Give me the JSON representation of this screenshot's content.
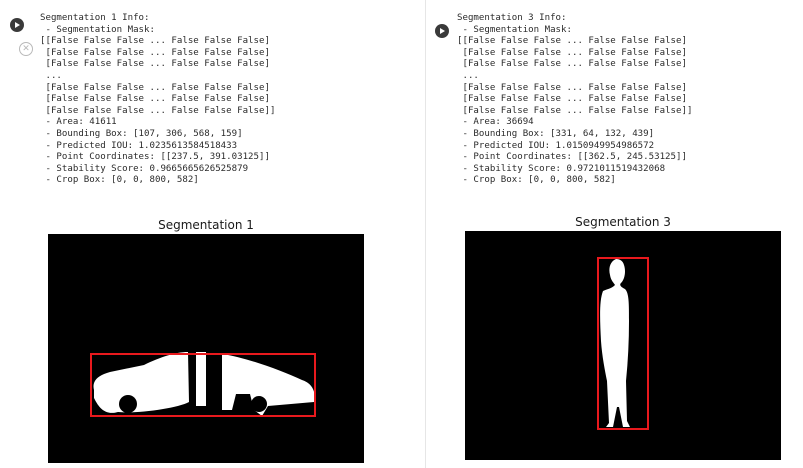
{
  "cells": [
    {
      "id": "seg1",
      "output_lines": [
        "Segmentation 1 Info:",
        " - Segmentation Mask:",
        "[[False False False ... False False False]",
        " [False False False ... False False False]",
        " [False False False ... False False False]",
        " ...",
        " [False False False ... False False False]",
        " [False False False ... False False False]",
        " [False False False ... False False False]]",
        " - Area: 41611",
        " - Bounding Box: [107, 306, 568, 159]",
        " - Predicted IOU: 1.0235613584518433",
        " - Point Coordinates: [[237.5, 391.03125]]",
        " - Stability Score: 0.9665665626525879",
        " - Crop Box: [0, 0, 800, 582]"
      ],
      "figure_title": "Segmentation 1",
      "bbox_color": "#e8191d"
    },
    {
      "id": "seg3",
      "output_lines": [
        "Segmentation 3 Info:",
        " - Segmentation Mask:",
        "[[False False False ... False False False]",
        " [False False False ... False False False]",
        " [False False False ... False False False]",
        " ...",
        " [False False False ... False False False]",
        " [False False False ... False False False]",
        " [False False False ... False False False]]",
        " - Area: 36694",
        " - Bounding Box: [331, 64, 132, 439]",
        " - Predicted IOU: 1.0150949954986572",
        " - Point Coordinates: [[362.5, 245.53125]]",
        " - Stability Score: 0.9721011519432068",
        " - Crop Box: [0, 0, 800, 582]"
      ],
      "figure_title": "Segmentation 3",
      "bbox_color": "#e8191d"
    }
  ],
  "icons": {
    "run": "play-circle-icon",
    "clear_output": "clear-output-icon"
  },
  "mask_colors": {
    "background": "#000000",
    "foreground": "#ffffff"
  }
}
